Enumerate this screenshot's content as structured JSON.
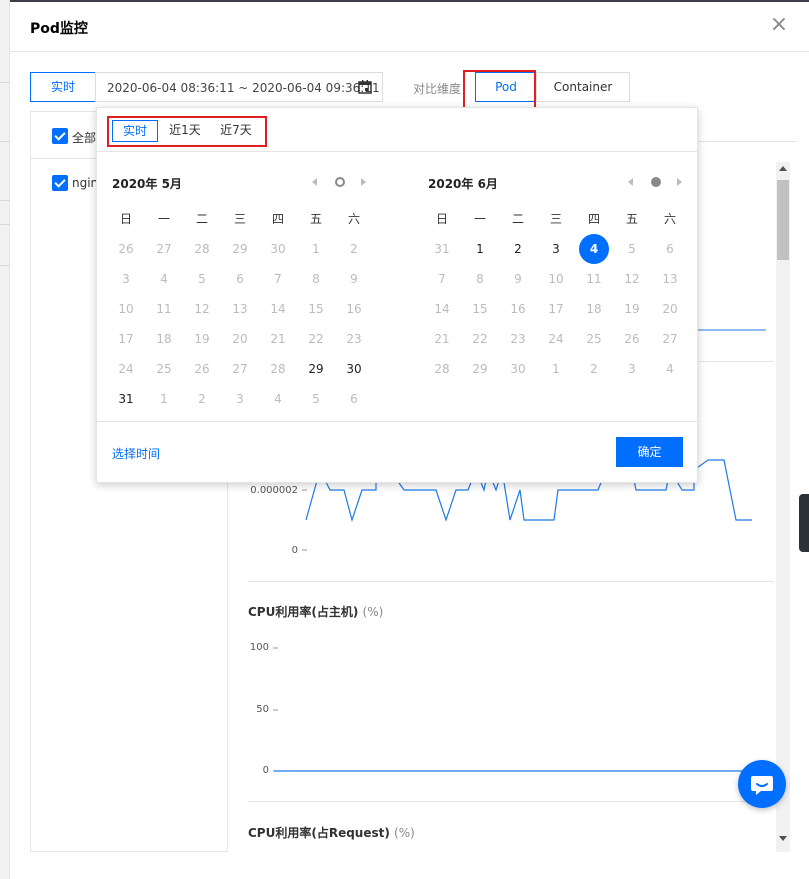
{
  "modal": {
    "title": "Pod监控",
    "close_icon": "close-icon"
  },
  "toolbar": {
    "realtime_label": "实时",
    "date_range": "2020-06-04 08:36:11 ~ 2020-06-04 09:36:11",
    "compare_label": "对比维度",
    "pod_label": "Pod",
    "container_label": "Container"
  },
  "left_panel": {
    "all_label": "全部",
    "items": [
      {
        "label": "nginx"
      }
    ]
  },
  "date_picker": {
    "quick": [
      "实时",
      "近1天",
      "近7天"
    ],
    "weekdays": [
      "日",
      "一",
      "二",
      "三",
      "四",
      "五",
      "六"
    ],
    "left_month": {
      "title": "2020年 5月",
      "days": [
        {
          "d": "26",
          "cur": false
        },
        {
          "d": "27",
          "cur": false
        },
        {
          "d": "28",
          "cur": false
        },
        {
          "d": "29",
          "cur": false
        },
        {
          "d": "30",
          "cur": false
        },
        {
          "d": "1",
          "cur": false
        },
        {
          "d": "2",
          "cur": false
        },
        {
          "d": "3",
          "cur": false
        },
        {
          "d": "4",
          "cur": false
        },
        {
          "d": "5",
          "cur": false
        },
        {
          "d": "6",
          "cur": false
        },
        {
          "d": "7",
          "cur": false
        },
        {
          "d": "8",
          "cur": false
        },
        {
          "d": "9",
          "cur": false
        },
        {
          "d": "10",
          "cur": false
        },
        {
          "d": "11",
          "cur": false
        },
        {
          "d": "12",
          "cur": false
        },
        {
          "d": "13",
          "cur": false
        },
        {
          "d": "14",
          "cur": false
        },
        {
          "d": "15",
          "cur": false
        },
        {
          "d": "16",
          "cur": false
        },
        {
          "d": "17",
          "cur": false
        },
        {
          "d": "18",
          "cur": false
        },
        {
          "d": "19",
          "cur": false
        },
        {
          "d": "20",
          "cur": false
        },
        {
          "d": "21",
          "cur": false
        },
        {
          "d": "22",
          "cur": false
        },
        {
          "d": "23",
          "cur": false
        },
        {
          "d": "24",
          "cur": false
        },
        {
          "d": "25",
          "cur": false
        },
        {
          "d": "26",
          "cur": false
        },
        {
          "d": "27",
          "cur": false
        },
        {
          "d": "28",
          "cur": false
        },
        {
          "d": "29",
          "cur": true
        },
        {
          "d": "30",
          "cur": true
        },
        {
          "d": "31",
          "cur": true
        },
        {
          "d": "1",
          "cur": false
        },
        {
          "d": "2",
          "cur": false
        },
        {
          "d": "3",
          "cur": false
        },
        {
          "d": "4",
          "cur": false
        },
        {
          "d": "5",
          "cur": false
        },
        {
          "d": "6",
          "cur": false
        }
      ]
    },
    "right_month": {
      "title": "2020年 6月",
      "days": [
        {
          "d": "31",
          "cur": false
        },
        {
          "d": "1",
          "cur": true
        },
        {
          "d": "2",
          "cur": true
        },
        {
          "d": "3",
          "cur": true
        },
        {
          "d": "4",
          "cur": true,
          "sel": true
        },
        {
          "d": "5",
          "cur": false
        },
        {
          "d": "6",
          "cur": false
        },
        {
          "d": "7",
          "cur": false
        },
        {
          "d": "8",
          "cur": false
        },
        {
          "d": "9",
          "cur": false
        },
        {
          "d": "10",
          "cur": false
        },
        {
          "d": "11",
          "cur": false
        },
        {
          "d": "12",
          "cur": false
        },
        {
          "d": "13",
          "cur": false
        },
        {
          "d": "14",
          "cur": false
        },
        {
          "d": "15",
          "cur": false
        },
        {
          "d": "16",
          "cur": false
        },
        {
          "d": "17",
          "cur": false
        },
        {
          "d": "18",
          "cur": false
        },
        {
          "d": "19",
          "cur": false
        },
        {
          "d": "20",
          "cur": false
        },
        {
          "d": "21",
          "cur": false
        },
        {
          "d": "22",
          "cur": false
        },
        {
          "d": "23",
          "cur": false
        },
        {
          "d": "24",
          "cur": false
        },
        {
          "d": "25",
          "cur": false
        },
        {
          "d": "26",
          "cur": false
        },
        {
          "d": "27",
          "cur": false
        },
        {
          "d": "28",
          "cur": false
        },
        {
          "d": "29",
          "cur": false
        },
        {
          "d": "30",
          "cur": false
        },
        {
          "d": "1",
          "cur": false
        },
        {
          "d": "2",
          "cur": false
        },
        {
          "d": "3",
          "cur": false
        },
        {
          "d": "4",
          "cur": false
        }
      ]
    },
    "select_time_label": "选择时间",
    "confirm_label": "确定"
  },
  "charts": {
    "first": {
      "y_ticks": [
        "0.000002",
        "0"
      ]
    },
    "cpu_host": {
      "title": "CPU利用率(占主机)",
      "unit": "(%)",
      "y_ticks": [
        "100",
        "50",
        "0"
      ]
    },
    "cpu_request": {
      "title": "CPU利用率(占Request)",
      "unit": "(%)"
    }
  },
  "colors": {
    "accent": "#006eff",
    "highlight": "#e02020"
  }
}
